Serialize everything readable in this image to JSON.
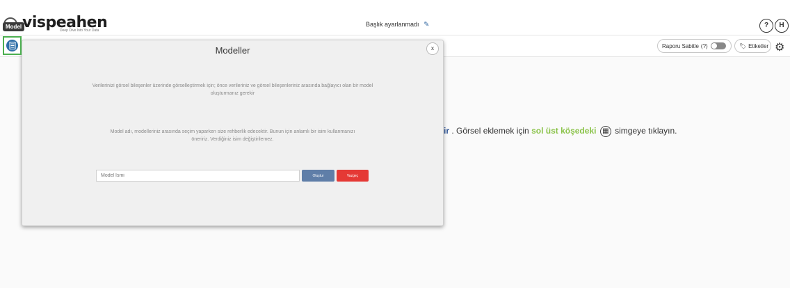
{
  "header": {
    "logo_text": "vispeahen",
    "logo_tagline": "Deep Dive Into Your Data",
    "report_title": "Başlık ayarlanmadı",
    "help_label": "?",
    "user_initial": "H"
  },
  "sidebar": {
    "model_tooltip": "Model"
  },
  "toolbar": {
    "pin_report_label": "Raporu Sabitle",
    "pin_report_hint": "(?)",
    "tags_label": "Etiketler"
  },
  "background_message": {
    "part1": "ir",
    "part2": ". Görsel eklemek için",
    "highlight": "sol üst köşedeki",
    "part3": "simgeye tıklayın."
  },
  "modal": {
    "title": "Modeller",
    "close_label": "x",
    "description1_line1": "Verilerinizi görsel bileşenler üzerinde görselleştirmek için; önce verileriniz ve görsel bileşenleriniz arasında bağlayıcı olan bir model",
    "description1_line2": "oluşturmanız gerekir",
    "description2_line1": "Model adı, modelleriniz arasında seçim yaparken size rehberlik edecektir. Bunun için anlamlı bir isim kullanmanızı",
    "description2_line2": "öneririz. Verdiğiniz isim değiştirilemez.",
    "name_placeholder": "Model İsmi",
    "create_label": "Oluştur",
    "cancel_label": "Vazgeç"
  },
  "colors": {
    "accent_blue": "#2f6fa8",
    "highlight_green": "#8bc34a",
    "create_button": "#5f7ea8",
    "cancel_button": "#e53935"
  }
}
